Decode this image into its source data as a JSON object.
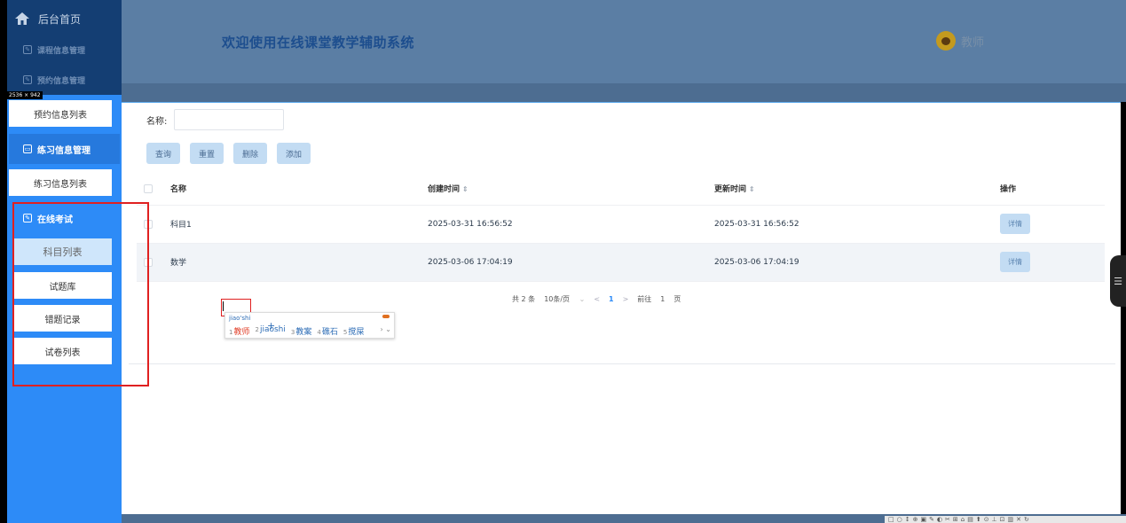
{
  "sidebar": {
    "home_label": "后台首页",
    "size_badge": "2536 × 942",
    "dim_items": [
      {
        "label": "课程信息管理"
      },
      {
        "label": "预约信息管理"
      }
    ],
    "appointment_list": "预约信息列表",
    "practice_header": "练习信息管理",
    "practice_list": "练习信息列表",
    "exam_header": "在线考试",
    "exam_items": [
      "科目列表",
      "试题库",
      "错题记录",
      "试卷列表"
    ]
  },
  "header": {
    "title": "欢迎使用在线课堂教学辅助系统",
    "user_name": "教师"
  },
  "search": {
    "name_label": "名称:",
    "name_value": ""
  },
  "buttons": {
    "query": "查询",
    "reset": "重置",
    "delete": "删除",
    "add": "添加"
  },
  "table": {
    "columns": [
      "名称",
      "创建时间",
      "更新时间",
      "操作"
    ],
    "sort_glyph": "⇕",
    "rows": [
      {
        "name": "科目1",
        "created": "2025-03-31 16:56:52",
        "updated": "2025-03-31 16:56:52",
        "action": "详情"
      },
      {
        "name": "数学",
        "created": "2025-03-06 17:04:19",
        "updated": "2025-03-06 17:04:19",
        "action": "详情"
      }
    ]
  },
  "pagination": {
    "total": "共 2 条",
    "page_size": "10条/页",
    "prev": "<",
    "current": "1",
    "next": ">",
    "goto_label": "前往",
    "goto_value": "1",
    "page_suffix": "页"
  },
  "ime": {
    "composition": "jiao'shi",
    "candidates": [
      {
        "num": "1",
        "text": "教师"
      },
      {
        "num": "2",
        "text": "jiaoshi"
      },
      {
        "num": "3",
        "text": "教案"
      },
      {
        "num": "4",
        "text": "礁石"
      },
      {
        "num": "5",
        "text": "搅屎"
      }
    ],
    "nav": "› ⌄"
  },
  "edge_tab_glyph": "☰",
  "toolbar_glyphs": "□○↕⊕▣✎◐✂⊞⌂▤⬆⊙⊥⊡▥✕↻",
  "colors": {
    "sidebar": "#2d8bf7",
    "header": "#5b7ea4",
    "highlight": "#e02020",
    "accent_button": "#c3dcf3"
  }
}
